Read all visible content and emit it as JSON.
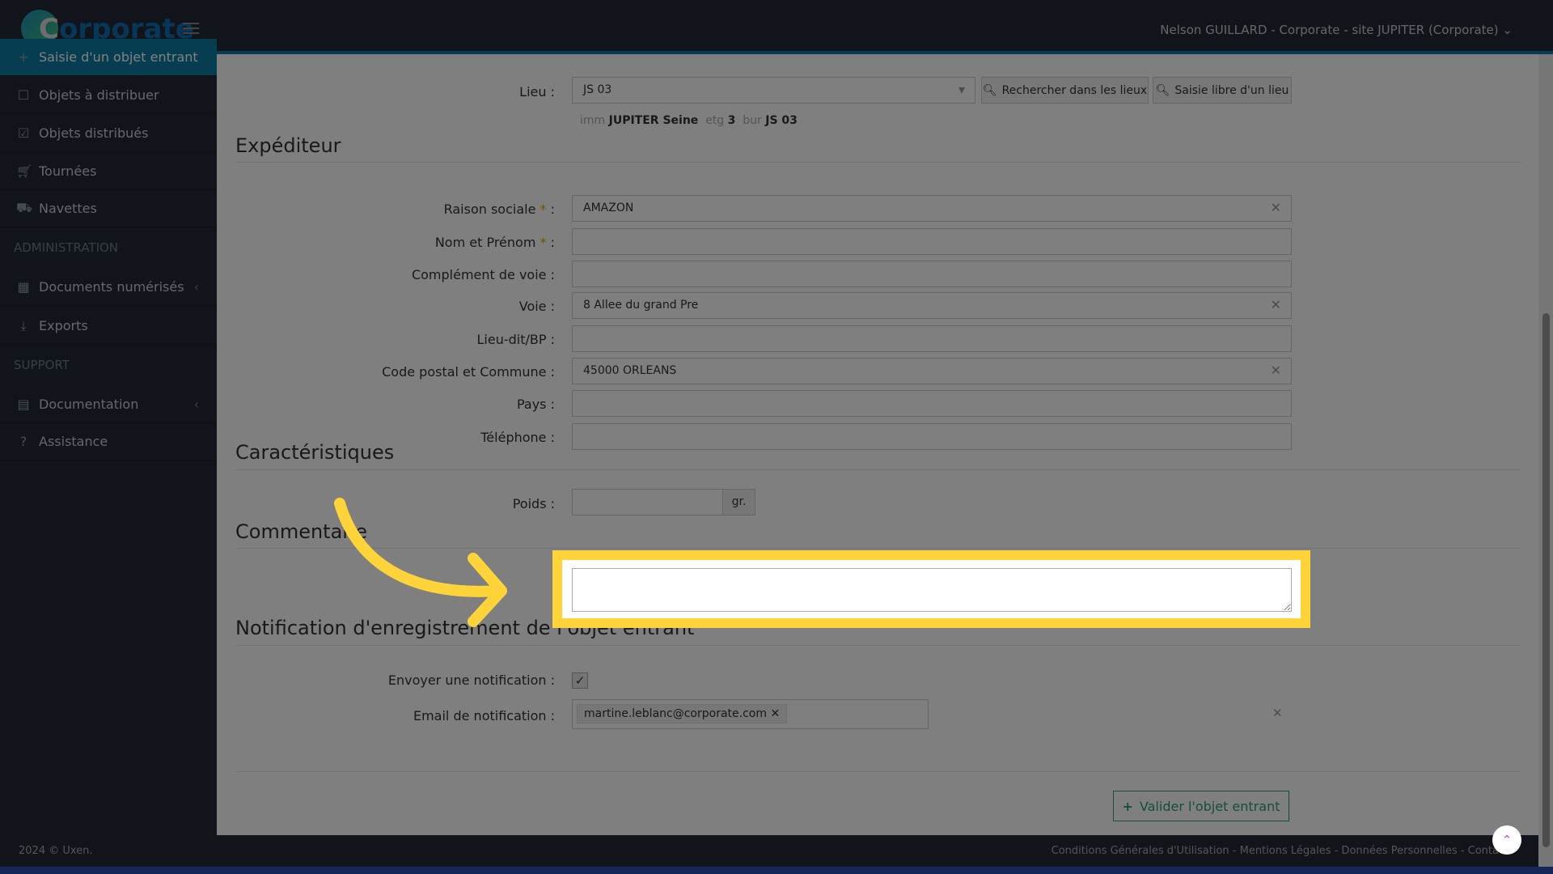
{
  "header": {
    "brand_initial": "C",
    "brand_rest": "orporate",
    "user": "Nelson GUILLARD - Corporate - site JUPITER (Corporate)"
  },
  "sidebar": {
    "items": [
      {
        "label": "Saisie d'un objet entrant",
        "icon": "plus-icon"
      },
      {
        "label": "Objets à distribuer",
        "icon": "square-icon"
      },
      {
        "label": "Objets distribués",
        "icon": "check-square-icon"
      },
      {
        "label": "Tournées",
        "icon": "cart-icon"
      },
      {
        "label": "Navettes",
        "icon": "truck-icon"
      },
      {
        "label": "Documents numérisés",
        "icon": "grid-icon"
      },
      {
        "label": "Exports",
        "icon": "download-icon"
      },
      {
        "label": "Documentation",
        "icon": "book-icon"
      },
      {
        "label": "Assistance",
        "icon": "question-icon"
      }
    ],
    "sections": {
      "admin": "ADMINISTRATION",
      "support": "SUPPORT"
    }
  },
  "lieu": {
    "label": "Lieu :",
    "value": "JS 03",
    "search_btn": "Rechercher dans les lieux",
    "free_btn": "Saisie libre d'un lieu",
    "detail": {
      "imm_label": "imm",
      "imm": "JUPITER Seine",
      "etg_label": "etg",
      "etg": "3",
      "bur_label": "bur",
      "bur": "JS 03"
    }
  },
  "expediteur": {
    "title": "Expéditeur",
    "fields": [
      {
        "label": "Raison sociale",
        "required": true,
        "value": "AMAZON"
      },
      {
        "label": "Nom et Prénom",
        "required": true,
        "value": ""
      },
      {
        "label": "Complément de voie",
        "required": false,
        "value": ""
      },
      {
        "label": "Voie",
        "required": false,
        "value": "8 Allee du grand Pre"
      },
      {
        "label": "Lieu-dit/BP",
        "required": false,
        "value": ""
      },
      {
        "label": "Code postal et Commune",
        "required": false,
        "value": "45000 ORLEANS"
      },
      {
        "label": "Pays",
        "required": false,
        "value": ""
      },
      {
        "label": "Téléphone",
        "required": false,
        "value": ""
      }
    ]
  },
  "caracteristiques": {
    "title": "Caractéristiques",
    "poids_label": "Poids :",
    "poids_value": "",
    "unit": "gr."
  },
  "commentaire": {
    "title": "Commentaire",
    "value": ""
  },
  "notification": {
    "title": "Notification d'enregistrement de l'objet entrant",
    "send_label": "Envoyer une notification :",
    "send_checked": true,
    "email_label": "Email de notification :",
    "emails": [
      "martine.leblanc@corporate.com"
    ]
  },
  "actions": {
    "submit": "Valider l'objet entrant"
  },
  "footer": {
    "copyright": "2024 © Uxen.",
    "links": "Conditions Générales d'Utilisation - Mentions Légales - Données Personnelles - Contacts"
  },
  "colors": {
    "highlight": "#ffd43b",
    "accent": "#0d7aa3",
    "submit": "#2a9d7f"
  }
}
